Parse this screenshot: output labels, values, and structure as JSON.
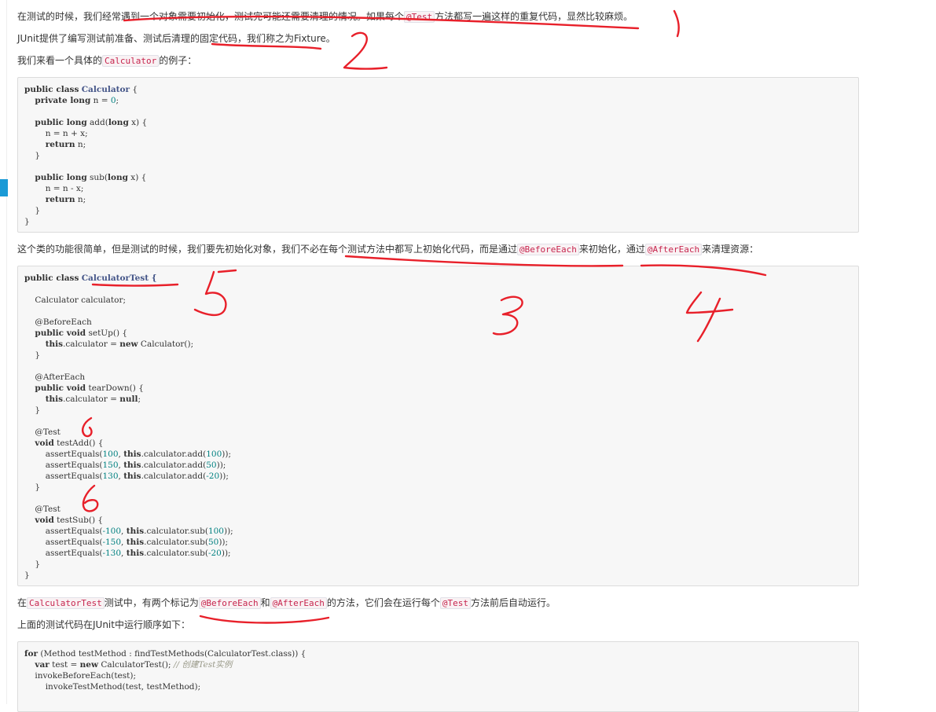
{
  "article": {
    "para1": {
      "a": "在测试的时候，我们经常遇到一个对象需要初始化，测试完可能还需要清理的情况。如果每个",
      "code": "@Test",
      "b": "方法都写一遍这样的重复代码，显然比较麻烦。"
    },
    "para2": {
      "a": "JUnit提供了编写测试前准备、测试后清理的固定代码，我们称之为Fixture。"
    },
    "para3": {
      "a": "我们来看一个具体的",
      "code": "Calculator",
      "b": "的例子："
    },
    "para4": {
      "a": "这个类的功能很简单，但是测试的时候，我们要先初始化对象，我们不必在每个测试方法中都写上初始化代码，而是通过",
      "code1": "@BeforeEach",
      "b": "来初始化，通过",
      "code2": "@AfterEach",
      "c": "来清理资源："
    },
    "para5": {
      "a": "在",
      "code1": "CalculatorTest",
      "b": "测试中，有两个标记为",
      "code2": "@BeforeEach",
      "c": "和",
      "code3": "@AfterEach",
      "d": "的方法，它们会在运行每个",
      "code4": "@Test",
      "e": "方法前后自动运行。"
    },
    "para6": {
      "a": "上面的测试代码在JUnit中运行顺序如下："
    }
  },
  "code1": {
    "l1": "public class",
    "l1b": "Calculator",
    "l1c": " {",
    "l2a": "    ",
    "l2k": "private long",
    " l2b": "",
    "l2c": " n = ",
    "l2n": "0",
    "l2d": ";",
    "l4k": "public long",
    "l4b": " add(",
    "l4k2": "long",
    "l4c": " x) {",
    "l5": "        n = n + x;",
    "l6k": "return",
    "l6b": " n;",
    "l7": "    }",
    "l9k": "public long",
    "l9b": " sub(",
    "l9k2": "long",
    "l9c": " x) {",
    "l10": "        n = n - x;",
    "l11k": "return",
    "l11b": " n;",
    "l12": "    }",
    "l13": "}"
  },
  "code2": {
    "l1k": "public class",
    "l1t": "CalculatorTest",
    "l1c": " {",
    "l3": "    Calculator calculator;",
    "l5": "    @BeforeEach",
    "l6k": "public void",
    "l6b": " setUp() {",
    "l7k": "this",
    "l7b": ".calculator = ",
    "l7k2": "new",
    "l7c": " Calculator();",
    "l8": "    }",
    "l10": "    @AfterEach",
    "l11k": "public void",
    "l11b": " tearDown() {",
    "l12k": "this",
    "l12b": ".calculator = ",
    "l12k2": "null",
    "l12c": ";",
    "l13": "    }",
    "l15": "    @Test",
    "l16k": "void",
    "l16b": " testAdd() {",
    "add": [
      {
        "n1": "100",
        "n2": "100"
      },
      {
        "n1": "150",
        "n2": "50"
      },
      {
        "n1": "130",
        "n2": "-20"
      }
    ],
    "l20": "    }",
    "l22": "    @Test",
    "l23k": "void",
    "l23b": " testSub() {",
    "sub": [
      {
        "n1": "-100",
        "n2": "100"
      },
      {
        "n1": "-150",
        "n2": "50"
      },
      {
        "n1": "-130",
        "n2": "-20"
      }
    ],
    "l27": "    }",
    "l28": "}",
    "assert": "assertEquals(",
    "this": "this",
    "addcall": ".calculator.add(",
    "subcall": ".calculator.sub(",
    "end": "));"
  },
  "code3": {
    "l1k": "for",
    "l1b": " (Method testMethod : findTestMethods(CalculatorTest.class)) {",
    "l2k": "var",
    "l2b": " test = ",
    "l2k2": "new",
    "l2c": " CalculatorTest(); ",
    "l2cm": "// 创建Test实例",
    "l3": "    invokeBeforeEach(test);",
    "l4": "        invokeTestMethod(test, testMethod);"
  },
  "annotations": [
    "1",
    "2",
    "3",
    "4",
    "5",
    "6",
    "6"
  ],
  "colors": {
    "accent": "#1a9ad6",
    "ink": "#e8202a",
    "code_bg": "#f7f7f7",
    "inline_code": "#c7254e"
  }
}
